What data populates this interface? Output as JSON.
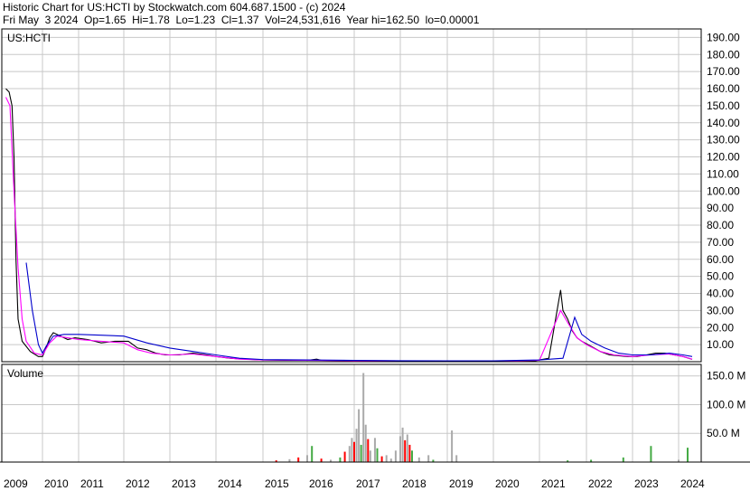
{
  "header": {
    "line1": "Historic Chart for US:HCTI by Stockwatch.com 604.687.1500 - (c) 2024",
    "line2": "Fri May  3 2024  Op=1.65  Hi=1.78  Lo=1.23  Cl=1.37  Vol=24,531,616  Year hi=162.50  lo=0.00001"
  },
  "chart_data": [
    {
      "type": "line",
      "panel": "price",
      "label": "US:HCTI",
      "x_labels": [
        "2009",
        "2010",
        "2011",
        "2012",
        "2013",
        "2014",
        "2015",
        "2016",
        "2017",
        "2018",
        "2019",
        "2020",
        "2021",
        "2022",
        "2023",
        "2024"
      ],
      "y_ticks": [
        "10.00",
        "20.00",
        "30.00",
        "40.00",
        "50.00",
        "60.00",
        "70.00",
        "80.00",
        "90.00",
        "100.00",
        "110.00",
        "120.00",
        "130.00",
        "140.00",
        "150.00",
        "160.00",
        "170.00",
        "180.00",
        "190.00"
      ],
      "ylim": [
        0,
        195
      ],
      "grid": true,
      "series": [
        {
          "color": "#000000",
          "points": [
            [
              2009.1,
              160
            ],
            [
              2009.18,
              158
            ],
            [
              2009.25,
              150
            ],
            [
              2009.3,
              120
            ],
            [
              2009.35,
              60
            ],
            [
              2009.4,
              25
            ],
            [
              2009.5,
              12
            ],
            [
              2009.7,
              6
            ],
            [
              2009.9,
              3
            ],
            [
              2010.0,
              3
            ],
            [
              2010.1,
              8
            ],
            [
              2010.2,
              14
            ],
            [
              2010.3,
              17
            ],
            [
              2010.5,
              15
            ],
            [
              2010.7,
              13
            ],
            [
              2010.9,
              14
            ],
            [
              2011.2,
              13
            ],
            [
              2011.5,
              11
            ],
            [
              2011.8,
              12
            ],
            [
              2012.1,
              12
            ],
            [
              2012.3,
              8
            ],
            [
              2012.5,
              7
            ],
            [
              2012.7,
              5
            ],
            [
              2012.9,
              4
            ],
            [
              2013.2,
              4
            ],
            [
              2013.5,
              5
            ],
            [
              2013.8,
              4
            ],
            [
              2014.0,
              3
            ],
            [
              2014.3,
              2
            ],
            [
              2014.6,
              1.5
            ],
            [
              2015.0,
              1
            ],
            [
              2015.5,
              0.8
            ],
            [
              2016.0,
              0.8
            ],
            [
              2016.2,
              1.5
            ],
            [
              2016.3,
              0.8
            ],
            [
              2017.0,
              0.6
            ],
            [
              2018.0,
              0.5
            ],
            [
              2019.0,
              0.4
            ],
            [
              2020.0,
              0.3
            ],
            [
              2020.9,
              0.5
            ],
            [
              2021.0,
              1
            ],
            [
              2021.2,
              2
            ],
            [
              2021.45,
              42
            ],
            [
              2021.5,
              30
            ],
            [
              2021.6,
              25
            ],
            [
              2021.7,
              18
            ],
            [
              2021.8,
              14
            ],
            [
              2021.9,
              12
            ],
            [
              2022.1,
              9
            ],
            [
              2022.3,
              6
            ],
            [
              2022.5,
              4
            ],
            [
              2022.7,
              3.5
            ],
            [
              2022.9,
              3
            ],
            [
              2023.1,
              3
            ],
            [
              2023.3,
              4
            ],
            [
              2023.5,
              5
            ],
            [
              2023.7,
              5
            ],
            [
              2023.9,
              4
            ],
            [
              2024.1,
              3
            ],
            [
              2024.3,
              1.4
            ]
          ]
        },
        {
          "color": "#ff00ff",
          "points": [
            [
              2009.1,
              155
            ],
            [
              2009.2,
              150
            ],
            [
              2009.3,
              100
            ],
            [
              2009.4,
              55
            ],
            [
              2009.5,
              25
            ],
            [
              2009.6,
              12
            ],
            [
              2009.8,
              5
            ],
            [
              2010.0,
              4
            ],
            [
              2010.2,
              11
            ],
            [
              2010.4,
              15
            ],
            [
              2010.7,
              14
            ],
            [
              2011.0,
              13
            ],
            [
              2011.5,
              12
            ],
            [
              2012.0,
              11
            ],
            [
              2012.3,
              7
            ],
            [
              2012.6,
              5
            ],
            [
              2013.0,
              4
            ],
            [
              2013.5,
              4.5
            ],
            [
              2014.0,
              3
            ],
            [
              2014.5,
              1.5
            ],
            [
              2015.0,
              1
            ],
            [
              2016.0,
              0.8
            ],
            [
              2017.0,
              0.6
            ],
            [
              2018.0,
              0.5
            ],
            [
              2019.0,
              0.4
            ],
            [
              2020.0,
              0.3
            ],
            [
              2021.0,
              0.8
            ],
            [
              2021.45,
              30
            ],
            [
              2021.6,
              23
            ],
            [
              2021.8,
              14
            ],
            [
              2022.0,
              10
            ],
            [
              2022.3,
              6
            ],
            [
              2022.6,
              4
            ],
            [
              2023.0,
              3
            ],
            [
              2023.4,
              4
            ],
            [
              2023.8,
              4.5
            ],
            [
              2024.1,
              3
            ],
            [
              2024.3,
              1.5
            ]
          ]
        },
        {
          "color": "#0000cc",
          "points": [
            [
              2009.6,
              58
            ],
            [
              2009.75,
              30
            ],
            [
              2009.9,
              10
            ],
            [
              2010.0,
              5
            ],
            [
              2010.1,
              9
            ],
            [
              2010.3,
              15
            ],
            [
              2010.6,
              16
            ],
            [
              2011.0,
              16
            ],
            [
              2011.5,
              15.5
            ],
            [
              2012.0,
              15
            ],
            [
              2012.5,
              11
            ],
            [
              2013.0,
              8
            ],
            [
              2013.5,
              6
            ],
            [
              2014.0,
              4
            ],
            [
              2014.5,
              2
            ],
            [
              2015.0,
              1.2
            ],
            [
              2016.0,
              1
            ],
            [
              2017.0,
              0.8
            ],
            [
              2018.0,
              0.6
            ],
            [
              2019.0,
              0.5
            ],
            [
              2020.0,
              0.5
            ],
            [
              2021.0,
              1
            ],
            [
              2021.5,
              2
            ],
            [
              2021.75,
              26
            ],
            [
              2021.9,
              16
            ],
            [
              2022.1,
              12
            ],
            [
              2022.4,
              8
            ],
            [
              2022.7,
              5
            ],
            [
              2023.0,
              4
            ],
            [
              2023.4,
              4
            ],
            [
              2023.8,
              5
            ],
            [
              2024.1,
              4
            ],
            [
              2024.3,
              3
            ]
          ]
        }
      ]
    },
    {
      "type": "bar",
      "panel": "volume",
      "label": "Volume",
      "y_ticks": [
        "50.0 M",
        "100.0 M",
        "150.0 M"
      ],
      "ylim": [
        0,
        170
      ],
      "grid": true,
      "bars": [
        {
          "x": 2015.3,
          "v": 3,
          "c": "#ff0000"
        },
        {
          "x": 2015.6,
          "v": 5,
          "c": "#aaaaaa"
        },
        {
          "x": 2015.8,
          "v": 8,
          "c": "#ff0000"
        },
        {
          "x": 2016.0,
          "v": 12,
          "c": "#aaaaaa"
        },
        {
          "x": 2016.1,
          "v": 28,
          "c": "#44aa44"
        },
        {
          "x": 2016.3,
          "v": 6,
          "c": "#ff0000"
        },
        {
          "x": 2016.5,
          "v": 4,
          "c": "#aaaaaa"
        },
        {
          "x": 2016.7,
          "v": 8,
          "c": "#44aa44"
        },
        {
          "x": 2016.8,
          "v": 18,
          "c": "#ff0000"
        },
        {
          "x": 2016.9,
          "v": 28,
          "c": "#aaaaaa"
        },
        {
          "x": 2016.95,
          "v": 42,
          "c": "#aaaaaa"
        },
        {
          "x": 2017.0,
          "v": 35,
          "c": "#ff0000"
        },
        {
          "x": 2017.05,
          "v": 58,
          "c": "#aaaaaa"
        },
        {
          "x": 2017.1,
          "v": 92,
          "c": "#aaaaaa"
        },
        {
          "x": 2017.15,
          "v": 30,
          "c": "#44aa44"
        },
        {
          "x": 2017.2,
          "v": 155,
          "c": "#aaaaaa"
        },
        {
          "x": 2017.25,
          "v": 65,
          "c": "#aaaaaa"
        },
        {
          "x": 2017.3,
          "v": 40,
          "c": "#ff0000"
        },
        {
          "x": 2017.35,
          "v": 20,
          "c": "#aaaaaa"
        },
        {
          "x": 2017.45,
          "v": 42,
          "c": "#aaaaaa"
        },
        {
          "x": 2017.5,
          "v": 24,
          "c": "#44aa44"
        },
        {
          "x": 2017.6,
          "v": 10,
          "c": "#ff0000"
        },
        {
          "x": 2017.7,
          "v": 12,
          "c": "#aaaaaa"
        },
        {
          "x": 2017.8,
          "v": 6,
          "c": "#aaaaaa"
        },
        {
          "x": 2017.9,
          "v": 20,
          "c": "#aaaaaa"
        },
        {
          "x": 2018.0,
          "v": 45,
          "c": "#aaaaaa"
        },
        {
          "x": 2018.05,
          "v": 60,
          "c": "#aaaaaa"
        },
        {
          "x": 2018.1,
          "v": 38,
          "c": "#ff0000"
        },
        {
          "x": 2018.15,
          "v": 48,
          "c": "#aaaaaa"
        },
        {
          "x": 2018.2,
          "v": 30,
          "c": "#ff0000"
        },
        {
          "x": 2018.25,
          "v": 20,
          "c": "#44aa44"
        },
        {
          "x": 2018.4,
          "v": 8,
          "c": "#aaaaaa"
        },
        {
          "x": 2018.6,
          "v": 12,
          "c": "#aaaaaa"
        },
        {
          "x": 2018.7,
          "v": 4,
          "c": "#44aa44"
        },
        {
          "x": 2019.1,
          "v": 55,
          "c": "#aaaaaa"
        },
        {
          "x": 2019.2,
          "v": 12,
          "c": "#aaaaaa"
        },
        {
          "x": 2021.6,
          "v": 3,
          "c": "#44aa44"
        },
        {
          "x": 2022.1,
          "v": 4,
          "c": "#44aa44"
        },
        {
          "x": 2022.8,
          "v": 8,
          "c": "#44aa44"
        },
        {
          "x": 2023.4,
          "v": 28,
          "c": "#44aa44"
        },
        {
          "x": 2024.0,
          "v": 4,
          "c": "#aaaaaa"
        },
        {
          "x": 2024.2,
          "v": 25,
          "c": "#44aa44"
        }
      ]
    }
  ]
}
